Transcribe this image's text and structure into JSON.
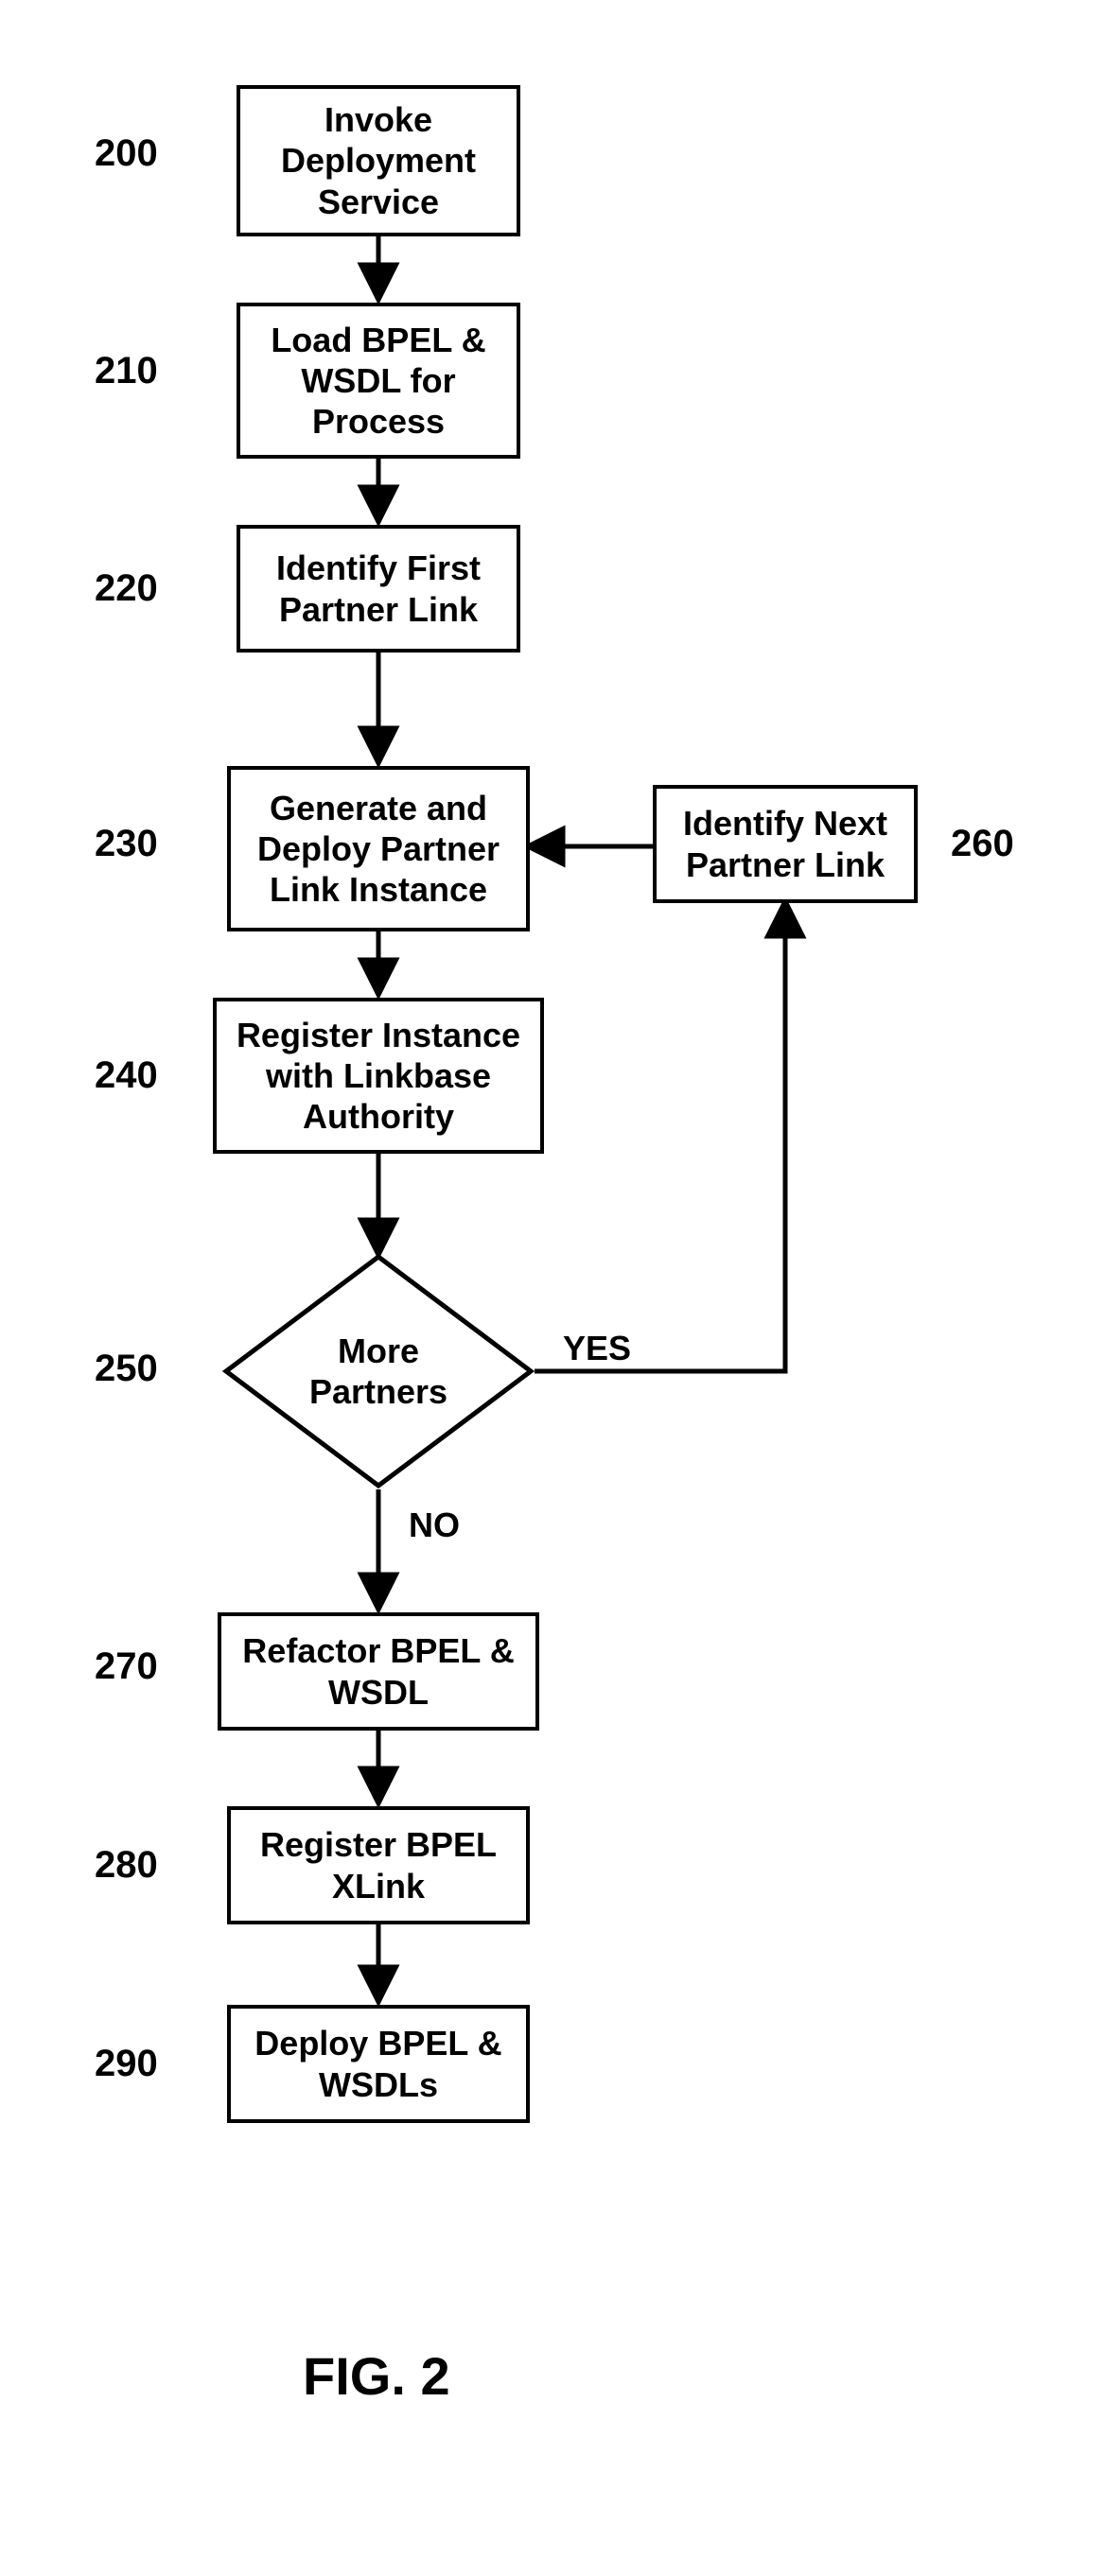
{
  "chart_data": {
    "type": "flowchart",
    "title": "FIG. 2",
    "nodes": [
      {
        "id": "200",
        "label": "Invoke Deployment Service",
        "shape": "rect"
      },
      {
        "id": "210",
        "label": "Load BPEL & WSDL for Process",
        "shape": "rect"
      },
      {
        "id": "220",
        "label": "Identify First Partner Link",
        "shape": "rect"
      },
      {
        "id": "230",
        "label": "Generate and Deploy Partner Link Instance",
        "shape": "rect"
      },
      {
        "id": "240",
        "label": "Register Instance with Linkbase Authority",
        "shape": "rect"
      },
      {
        "id": "250",
        "label": "More Partners",
        "shape": "diamond"
      },
      {
        "id": "260",
        "label": "Identify Next Partner Link",
        "shape": "rect"
      },
      {
        "id": "270",
        "label": "Refactor BPEL & WSDL",
        "shape": "rect"
      },
      {
        "id": "280",
        "label": "Register BPEL XLink",
        "shape": "rect"
      },
      {
        "id": "290",
        "label": "Deploy BPEL & WSDLs",
        "shape": "rect"
      }
    ],
    "edges": [
      {
        "from": "200",
        "to": "210",
        "label": ""
      },
      {
        "from": "210",
        "to": "220",
        "label": ""
      },
      {
        "from": "220",
        "to": "230",
        "label": ""
      },
      {
        "from": "230",
        "to": "240",
        "label": ""
      },
      {
        "from": "240",
        "to": "250",
        "label": ""
      },
      {
        "from": "250",
        "to": "260",
        "label": "YES"
      },
      {
        "from": "260",
        "to": "230",
        "label": ""
      },
      {
        "from": "250",
        "to": "270",
        "label": "NO"
      },
      {
        "from": "270",
        "to": "280",
        "label": ""
      },
      {
        "from": "280",
        "to": "290",
        "label": ""
      }
    ]
  },
  "nodes": {
    "n200": {
      "num": "200",
      "text": "Invoke\nDeployment\nService"
    },
    "n210": {
      "num": "210",
      "text": "Load BPEL &\nWSDL for\nProcess"
    },
    "n220": {
      "num": "220",
      "text": "Identify First\nPartner Link"
    },
    "n230": {
      "num": "230",
      "text": "Generate and\nDeploy Partner\nLink Instance"
    },
    "n240": {
      "num": "240",
      "text": "Register Instance\nwith Linkbase\nAuthority"
    },
    "n250": {
      "num": "250",
      "text": "More\nPartners"
    },
    "n260": {
      "num": "260",
      "text": "Identify Next\nPartner Link"
    },
    "n270": {
      "num": "270",
      "text": "Refactor BPEL &\nWSDL"
    },
    "n280": {
      "num": "280",
      "text": "Register BPEL\nXLink"
    },
    "n290": {
      "num": "290",
      "text": "Deploy BPEL &\nWSDLs"
    }
  },
  "labels": {
    "yes": "YES",
    "no": "NO",
    "fig": "FIG. 2"
  }
}
